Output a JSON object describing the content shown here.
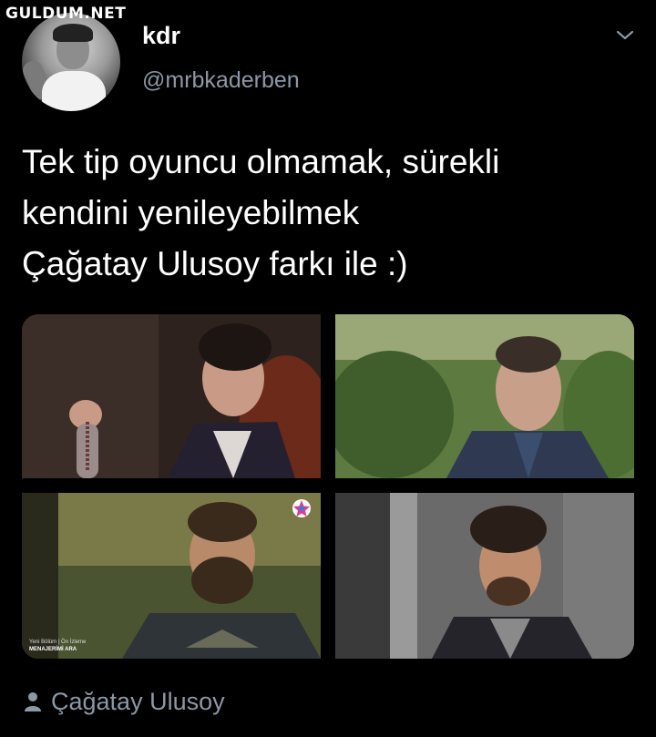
{
  "watermark": "GULDUM.NET",
  "user": {
    "display_name": "kdr",
    "handle": "@mrbkaderben"
  },
  "tweet": {
    "lines": [
      "Tek tip oyuncu olmamak, sürekli",
      "kendini yenileyebilmek",
      "Çağatay Ulusoy farkı ile :)"
    ]
  },
  "media": {
    "photo3_badge": {
      "line1": "Yeni Bölüm | Ön İzleme",
      "line2": "MENAJERİMİ ARA"
    }
  },
  "footer": {
    "tag_label": "Çağatay Ulusoy",
    "icon": "person-icon"
  },
  "colors": {
    "background": "#000000",
    "text": "#ffffff",
    "secondary": "#8b98a5"
  }
}
